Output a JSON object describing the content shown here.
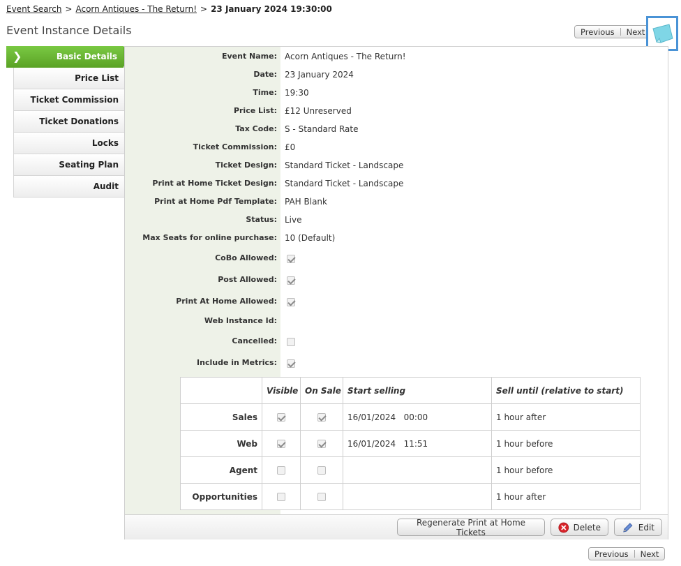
{
  "breadcrumb": {
    "link1": "Event Search",
    "link2": "Acorn Antiques - The Return!",
    "separator": ">",
    "current": "23 January 2024 19:30:00"
  },
  "page_title": "Event Instance Details",
  "pager": {
    "previous": "Previous",
    "next": "Next"
  },
  "tabs": [
    {
      "label": "Basic Details",
      "active": true
    },
    {
      "label": "Price List"
    },
    {
      "label": "Ticket Commission"
    },
    {
      "label": "Ticket Donations"
    },
    {
      "label": "Locks"
    },
    {
      "label": "Seating Plan"
    },
    {
      "label": "Audit"
    }
  ],
  "fields": [
    {
      "label": "Event Name:",
      "value": "Acorn Antiques - The Return!"
    },
    {
      "label": "Date:",
      "value": "23 January 2024"
    },
    {
      "label": "Time:",
      "value": "19:30"
    },
    {
      "label": "Price List:",
      "value": "£12 Unreserved"
    },
    {
      "label": "Tax Code:",
      "value": "S - Standard Rate"
    },
    {
      "label": "Ticket Commission:",
      "value": "£0"
    },
    {
      "label": "Ticket Design:",
      "value": "Standard Ticket - Landscape"
    },
    {
      "label": "Print at Home Ticket Design:",
      "value": "Standard Ticket - Landscape"
    },
    {
      "label": "Print at Home Pdf Template:",
      "value": "PAH Blank"
    },
    {
      "label": "Status:",
      "value": "Live"
    },
    {
      "label": "Max Seats for online purchase:",
      "value": "10 (Default)"
    }
  ],
  "checkbox_fields": [
    {
      "label": "CoBo Allowed:",
      "checked": true
    },
    {
      "label": "Post Allowed:",
      "checked": true
    },
    {
      "label": "Print At Home Allowed:",
      "checked": true
    },
    {
      "label": "Web Instance Id:",
      "value": ""
    },
    {
      "label": "Cancelled:",
      "checked": false
    },
    {
      "label": "Include in Metrics:",
      "checked": true
    }
  ],
  "channels": {
    "headers": {
      "visible": "Visible",
      "on_sale": "On Sale",
      "start": "Start selling",
      "until": "Sell until (relative to start)"
    },
    "rows": [
      {
        "name": "Sales",
        "visible": true,
        "on_sale": true,
        "start": "16/01/2024   00:00",
        "until": "1 hour after"
      },
      {
        "name": "Web",
        "visible": true,
        "on_sale": true,
        "start": "16/01/2024   11:51",
        "until": "1 hour before"
      },
      {
        "name": "Agent",
        "visible": false,
        "on_sale": false,
        "start": "",
        "until": "1 hour before"
      },
      {
        "name": "Opportunities",
        "visible": false,
        "on_sale": false,
        "start": "",
        "until": "1 hour after"
      }
    ]
  },
  "actions": {
    "regenerate": "Regenerate Print at Home Tickets",
    "delete": "Delete",
    "edit": "Edit"
  },
  "colors": {
    "tab_active": "#6db33f",
    "label_column": "#eef2e8",
    "note_icon": "#7fd6e6",
    "highlight_border": "#4a93d6"
  }
}
